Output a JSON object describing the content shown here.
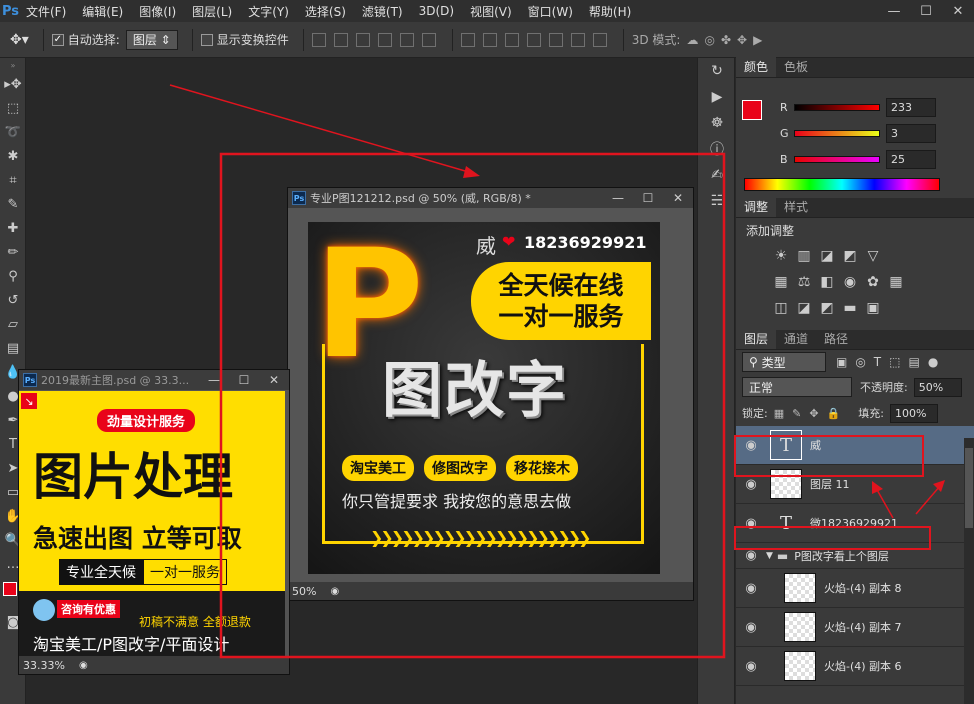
{
  "menubar": {
    "logo": "Ps",
    "items": [
      "文件(F)",
      "编辑(E)",
      "图像(I)",
      "图层(L)",
      "文字(Y)",
      "选择(S)",
      "滤镜(T)",
      "3D(D)",
      "视图(V)",
      "窗口(W)",
      "帮助(H)"
    ]
  },
  "options": {
    "auto_select_label": "自动选择:",
    "auto_select_value": "图层",
    "show_transform_label": "显示变换控件",
    "mode_label": "3D 模式:"
  },
  "color_panel": {
    "tabs": [
      "颜色",
      "色板"
    ],
    "r_label": "R",
    "g_label": "G",
    "b_label": "B",
    "r": "233",
    "g": "3",
    "b": "25",
    "foreground": "#e90319"
  },
  "adjust_panel": {
    "tabs": [
      "调整",
      "样式"
    ],
    "add_label": "添加调整"
  },
  "layers_panel": {
    "tabs": [
      "图层",
      "通道",
      "路径"
    ],
    "kind_label": "类型",
    "blend_mode": "正常",
    "opacity_label": "不透明度:",
    "opacity": "50%",
    "lock_label": "锁定:",
    "fill_label": "填充:",
    "fill": "100%",
    "layers": [
      {
        "name": "威",
        "kind": "text"
      },
      {
        "name": "图层 11",
        "kind": "raster"
      },
      {
        "name": "微18236929921",
        "kind": "text"
      },
      {
        "name": "P图改字看上个图层",
        "kind": "group"
      },
      {
        "name": "火焰-(4) 副本 8",
        "kind": "fire"
      },
      {
        "name": "火焰-(4) 副本 7",
        "kind": "fire"
      },
      {
        "name": "火焰-(4) 副本 6",
        "kind": "fire"
      }
    ]
  },
  "main_doc": {
    "title": "专业P图121212.psd @ 50% (威, RGB/8) *",
    "zoom": "50%",
    "art": {
      "wei": "威",
      "phone": "18236929921",
      "badge_line1": "全天候在线",
      "badge_line2": "一对一服务",
      "headline": "图改字",
      "chips": [
        "淘宝美工",
        "修图改字",
        "移花接木"
      ],
      "slogan": "你只管提要求 我按您的意思去做",
      "big_letter": "P"
    }
  },
  "second_doc": {
    "title": "2019最新主图.psd @ 33.3...",
    "zoom": "33.33%",
    "art": {
      "tag": "劲量设计服务",
      "headline": "图片处理",
      "subline": "急速出图 立等可取",
      "box1": "专业全天候",
      "box2": "一对一服务",
      "consult": "咨询有优惠",
      "guarantee": "初稿不满意 全额退款",
      "footer": "淘宝美工/P图改字/平面设计"
    }
  },
  "colors": {
    "ps_bg": "#282828",
    "panel": "#3a3a3a",
    "annotation_red": "#e0141e",
    "yellow": "#ffd400"
  }
}
